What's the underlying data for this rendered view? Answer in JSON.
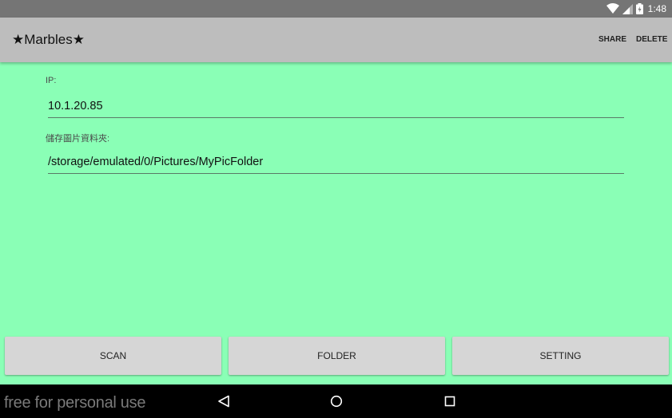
{
  "status_bar": {
    "time": "1:48",
    "icons": [
      "wifi-icon",
      "signal-icon",
      "battery-icon"
    ]
  },
  "app_bar": {
    "title": "★Marbles★",
    "actions": {
      "share": "SHARE",
      "delete": "DELETE"
    }
  },
  "form": {
    "ip_label": "IP:",
    "ip_value": "10.1.20.85",
    "folder_label": "儲存圖片資料夾:",
    "folder_value": "/storage/emulated/0/Pictures/MyPicFolder"
  },
  "buttons": {
    "scan": "SCAN",
    "folder": "FOLDER",
    "setting": "SETTING"
  },
  "nav_bar": {
    "icons": [
      "back-icon",
      "home-icon",
      "recent-apps-icon"
    ]
  },
  "watermark": "free for personal use",
  "colors": {
    "background": "#8affb6",
    "app_bar": "#bdbdbd",
    "status_bar": "#757575",
    "button": "#d6d6d6",
    "nav_bar": "#000000"
  }
}
